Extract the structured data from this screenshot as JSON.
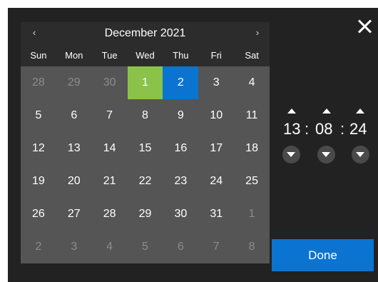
{
  "calendar": {
    "month_label": "December 2021",
    "prev_glyph": "‹",
    "next_glyph": "›",
    "weekdays": [
      "Sun",
      "Mon",
      "Tue",
      "Wed",
      "Thu",
      "Fri",
      "Sat"
    ],
    "weeks": [
      [
        "28",
        "29",
        "30",
        "1",
        "2",
        "3",
        "4"
      ],
      [
        "5",
        "6",
        "7",
        "8",
        "9",
        "10",
        "11"
      ],
      [
        "12",
        "13",
        "14",
        "15",
        "16",
        "17",
        "18"
      ],
      [
        "19",
        "20",
        "21",
        "22",
        "23",
        "24",
        "25"
      ],
      [
        "26",
        "27",
        "28",
        "29",
        "30",
        "31",
        "1"
      ],
      [
        "2",
        "3",
        "4",
        "5",
        "6",
        "7",
        "8"
      ]
    ]
  },
  "time": {
    "hours": "13",
    "minutes": "08",
    "seconds": "24",
    "separator": ":"
  },
  "actions": {
    "done_label": "Done"
  },
  "colors": {
    "today": "#8bc34a",
    "selected": "#0a74d0",
    "panel": "#222222",
    "grid": "#555555"
  }
}
